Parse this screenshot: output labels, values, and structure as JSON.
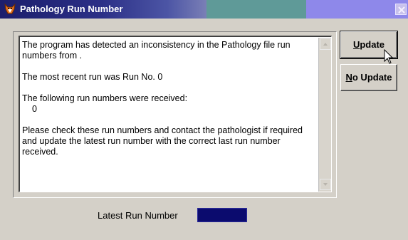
{
  "window": {
    "title": "Pathology Run Number"
  },
  "message": {
    "line1": "The program has detected an inconsistency in the Pathology file run numbers from .",
    "line2": "The most recent run was Run No. 0",
    "line3": "The following run numbers were received:",
    "run_numbers": [
      "0"
    ],
    "line4": "Please check these run numbers and contact the pathologist if required and update the latest run number with the correct last run number received."
  },
  "buttons": {
    "update_mnemonic": "U",
    "update_rest": "pdate",
    "noupdate_mnemonic": "N",
    "noupdate_rest": "o Update"
  },
  "latest": {
    "label": "Latest Run Number",
    "value": ""
  },
  "colors": {
    "dialog_bg": "#d4d0c8",
    "title_dark": "#1c1e6c",
    "title_teal": "#5f9a98",
    "title_lavender": "#8e88ea",
    "field_bg": "#0b0b6e"
  },
  "icons": {
    "app": "app-animal-icon",
    "close": "close-icon",
    "scroll_up": "scroll-up-arrow-icon",
    "scroll_down": "scroll-down-arrow-icon",
    "cursor": "mouse-pointer-icon"
  }
}
